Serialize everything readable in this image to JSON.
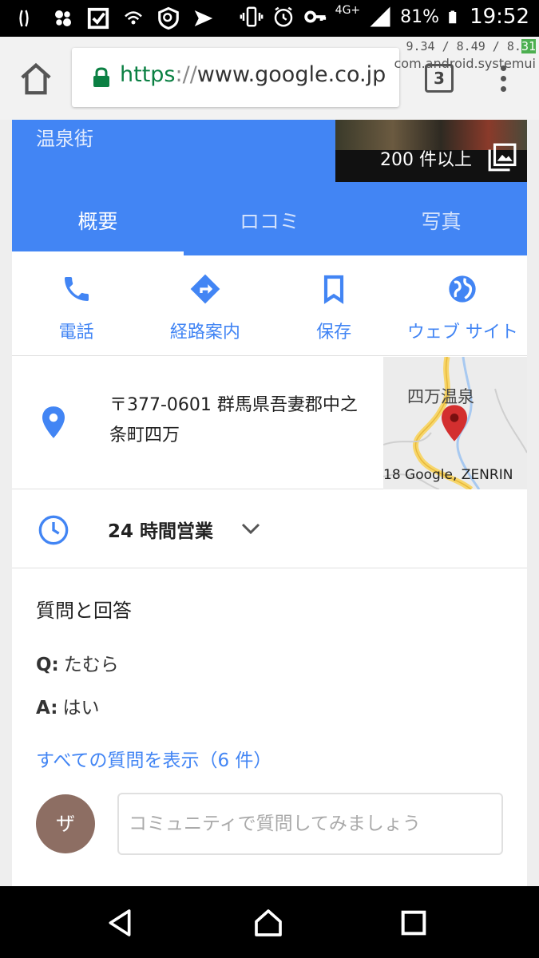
{
  "status_bar": {
    "network": "4G+",
    "battery": "81%",
    "time": "19:52",
    "icons": [
      "sim-icon",
      "pinwheel-icon",
      "checkbox-icon",
      "wifi-calling-icon",
      "shield-icon",
      "send-icon",
      "vibrate-icon",
      "alarm-icon",
      "key-icon",
      "signal-icon",
      "battery-icon"
    ]
  },
  "browser": {
    "url_scheme": "https",
    "url_separator": "://",
    "url_host": "www.google.co.jp",
    "tab_count": "3",
    "overlay_stats_prefix": "9.34 / 8.49 / 8.",
    "overlay_stats_highlight": "31",
    "overlay_package": "com.android.systemui"
  },
  "place": {
    "subtitle": "温泉街",
    "photo_count": "200 件以上",
    "tabs": [
      {
        "label": "概要",
        "active": true
      },
      {
        "label": "ロコミ",
        "active": false
      },
      {
        "label": "写真",
        "active": false
      }
    ],
    "actions": [
      {
        "label": "電話",
        "icon": "phone-icon"
      },
      {
        "label": "経路案内",
        "icon": "directions-icon"
      },
      {
        "label": "保存",
        "icon": "bookmark-icon"
      },
      {
        "label": "ウェブ サイト",
        "icon": "globe-icon"
      }
    ],
    "address": "〒377-0601 群馬県吾妻郡中之条町四万",
    "map_label": "四万温泉",
    "map_credit": "18 Google, ZENRIN",
    "hours": "24 時間営業"
  },
  "qa": {
    "title": "質問と回答",
    "q_prefix": "Q:",
    "question": "たむら",
    "a_prefix": "A:",
    "answer": "はい",
    "show_all": "すべての質問を表示（6 件）",
    "avatar_initial": "ザ",
    "ask_placeholder": "コミュニティで質問してみましょう"
  },
  "colors": {
    "accent": "#4285f4",
    "secure": "#0b8043",
    "pin": "#d32f2f"
  }
}
